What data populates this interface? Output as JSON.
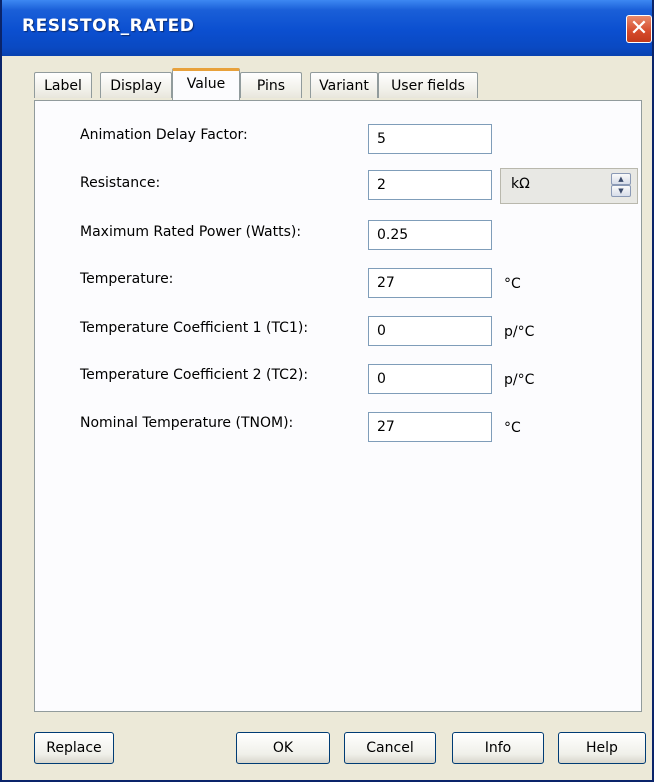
{
  "window": {
    "title": "RESISTOR_RATED",
    "close_glyph": "✕"
  },
  "tabs": [
    {
      "label": "Label"
    },
    {
      "label": "Display"
    },
    {
      "label": "Value",
      "active": true
    },
    {
      "label": "Pins"
    },
    {
      "label": "Variant"
    },
    {
      "label": "User fields"
    }
  ],
  "fields": {
    "animation_delay": {
      "label": "Animation Delay Factor:",
      "value": "5",
      "unit": ""
    },
    "resistance": {
      "label": "Resistance:",
      "value": "2",
      "unit": "kΩ"
    },
    "max_power": {
      "label": "Maximum Rated Power (Watts):",
      "value": "0.25",
      "unit": ""
    },
    "temperature": {
      "label": "Temperature:",
      "value": "27",
      "unit": "°C"
    },
    "tc1": {
      "label": "Temperature Coefficient 1 (TC1):",
      "value": "0",
      "unit": "p/°C"
    },
    "tc2": {
      "label": "Temperature Coefficient 2 (TC2):",
      "value": "0",
      "unit": "p/°C"
    },
    "tnom": {
      "label": "Nominal Temperature (TNOM):",
      "value": "27",
      "unit": "°C"
    }
  },
  "buttons": {
    "replace": "Replace",
    "ok": "OK",
    "cancel": "Cancel",
    "info": "Info",
    "help": "Help"
  },
  "colors": {
    "title_bar": "#0b4fd0",
    "active_tab_accent": "#e8a13b",
    "dialog_bg": "#ece9d8"
  }
}
